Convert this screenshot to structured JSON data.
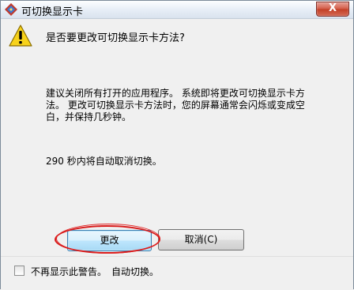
{
  "window": {
    "title": "可切换显示卡",
    "close_label": "X"
  },
  "dialog": {
    "question": "是否要更改可切换显示卡方法?",
    "advice": "建议关闭所有打开的应用程序。 系统即将更改可切换显示卡方法。 更改可切换显示卡方法时，您的屏幕通常会闪烁或变成空白，并保持几秒钟。",
    "countdown": "290 秒内将自动取消切换。",
    "countdown_seconds": 290
  },
  "buttons": {
    "change_label": "更改",
    "cancel_label": "取消(C)"
  },
  "footer": {
    "checkbox_label": "不再显示此警告。",
    "checkbox_checked": false,
    "auto_switch_label": "自动切换。"
  },
  "icons": {
    "app": "display-switch-icon",
    "warning": "warning-icon",
    "close": "close-icon"
  },
  "colors": {
    "annotation_oval": "#d81818",
    "close_button": "#c23e25",
    "default_button_border": "#3c7fb1"
  }
}
